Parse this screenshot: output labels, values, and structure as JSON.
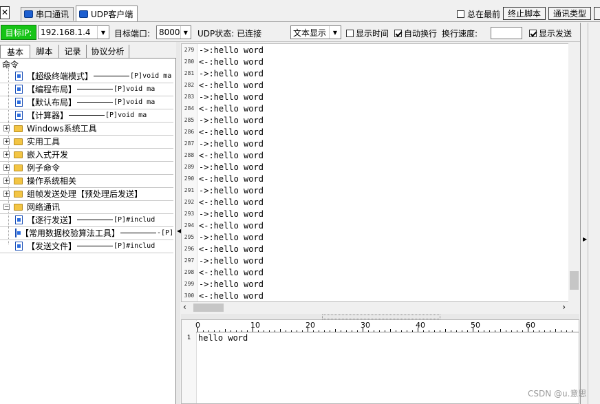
{
  "tabs": [
    {
      "label": "串口通讯",
      "active": false
    },
    {
      "label": "UDP客户端",
      "active": true
    }
  ],
  "topright": {
    "always_on_top_label": "总在最前",
    "always_on_top_checked": false,
    "stop_script_label": "终止脚本",
    "comm_type_label": "通讯类型"
  },
  "toolbar": {
    "target_ip_label": "目标IP:",
    "target_ip_value": "192.168.1.4",
    "target_port_label": "目标端口:",
    "target_port_value": "8000",
    "udp_status": "UDP状态: 已连接",
    "display_mode": "文本显示",
    "show_time_label": "显示时间",
    "show_time_checked": false,
    "auto_wrap_label": "自动换行",
    "auto_wrap_checked": true,
    "line_speed_label": "换行速度:",
    "line_speed_value": "",
    "show_send_label": "显示发送",
    "show_send_checked": true
  },
  "left_tabs": [
    "基本",
    "脚本",
    "记录",
    "协议分析"
  ],
  "tree": {
    "root": "命令",
    "items": [
      {
        "type": "cmd",
        "label": "【超级终端模式】",
        "code": "[P]void ma"
      },
      {
        "type": "cmd",
        "label": "【编程布局】",
        "code": "[P]void ma"
      },
      {
        "type": "cmd",
        "label": "【默认布局】",
        "code": "[P]void ma"
      },
      {
        "type": "cmd",
        "label": "【计算器】",
        "code": "[P]void ma"
      },
      {
        "type": "folder",
        "label": "Windows系统工具"
      },
      {
        "type": "folder",
        "label": "实用工具"
      },
      {
        "type": "folder",
        "label": "嵌入式开发"
      },
      {
        "type": "folder",
        "label": "例子命令"
      },
      {
        "type": "folder",
        "label": "操作系统相关"
      },
      {
        "type": "folder",
        "label": "组帧发送处理【预处理后发送】"
      },
      {
        "type": "folder-open",
        "label": "网络通讯"
      },
      {
        "type": "cmd",
        "label": "【逐行发送】",
        "code": "[P]#includ"
      },
      {
        "type": "cmd",
        "label": "【常用数据校验算法工具】",
        "code": "-[P] #defin"
      },
      {
        "type": "cmd",
        "label": "【发送文件】",
        "code": "[P]#includ"
      }
    ]
  },
  "log": [
    {
      "n": "279",
      "text": "->:hello word"
    },
    {
      "n": "280",
      "text": "<-:hello word"
    },
    {
      "n": "281",
      "text": "->:hello word"
    },
    {
      "n": "282",
      "text": "<-:hello word"
    },
    {
      "n": "283",
      "text": "->:hello word"
    },
    {
      "n": "284",
      "text": "<-:hello word"
    },
    {
      "n": "285",
      "text": "->:hello word"
    },
    {
      "n": "286",
      "text": "<-:hello word"
    },
    {
      "n": "287",
      "text": "->:hello word"
    },
    {
      "n": "288",
      "text": "<-:hello word"
    },
    {
      "n": "289",
      "text": "->:hello word"
    },
    {
      "n": "290",
      "text": "<-:hello word"
    },
    {
      "n": "291",
      "text": "->:hello word"
    },
    {
      "n": "292",
      "text": "<-:hello word"
    },
    {
      "n": "293",
      "text": "->:hello word"
    },
    {
      "n": "294",
      "text": "<-:hello word"
    },
    {
      "n": "295",
      "text": "->:hello word"
    },
    {
      "n": "296",
      "text": "<-:hello word"
    },
    {
      "n": "297",
      "text": "->:hello word"
    },
    {
      "n": "298",
      "text": "<-:hello word"
    },
    {
      "n": "299",
      "text": "->:hello word"
    },
    {
      "n": "300",
      "text": "<-:hello word"
    }
  ],
  "ruler": [
    "0",
    "10",
    "20",
    "30",
    "40",
    "50",
    "60"
  ],
  "editor": {
    "line_number": "1",
    "text": "hello word"
  },
  "watermark": "CSDN @u.意思"
}
